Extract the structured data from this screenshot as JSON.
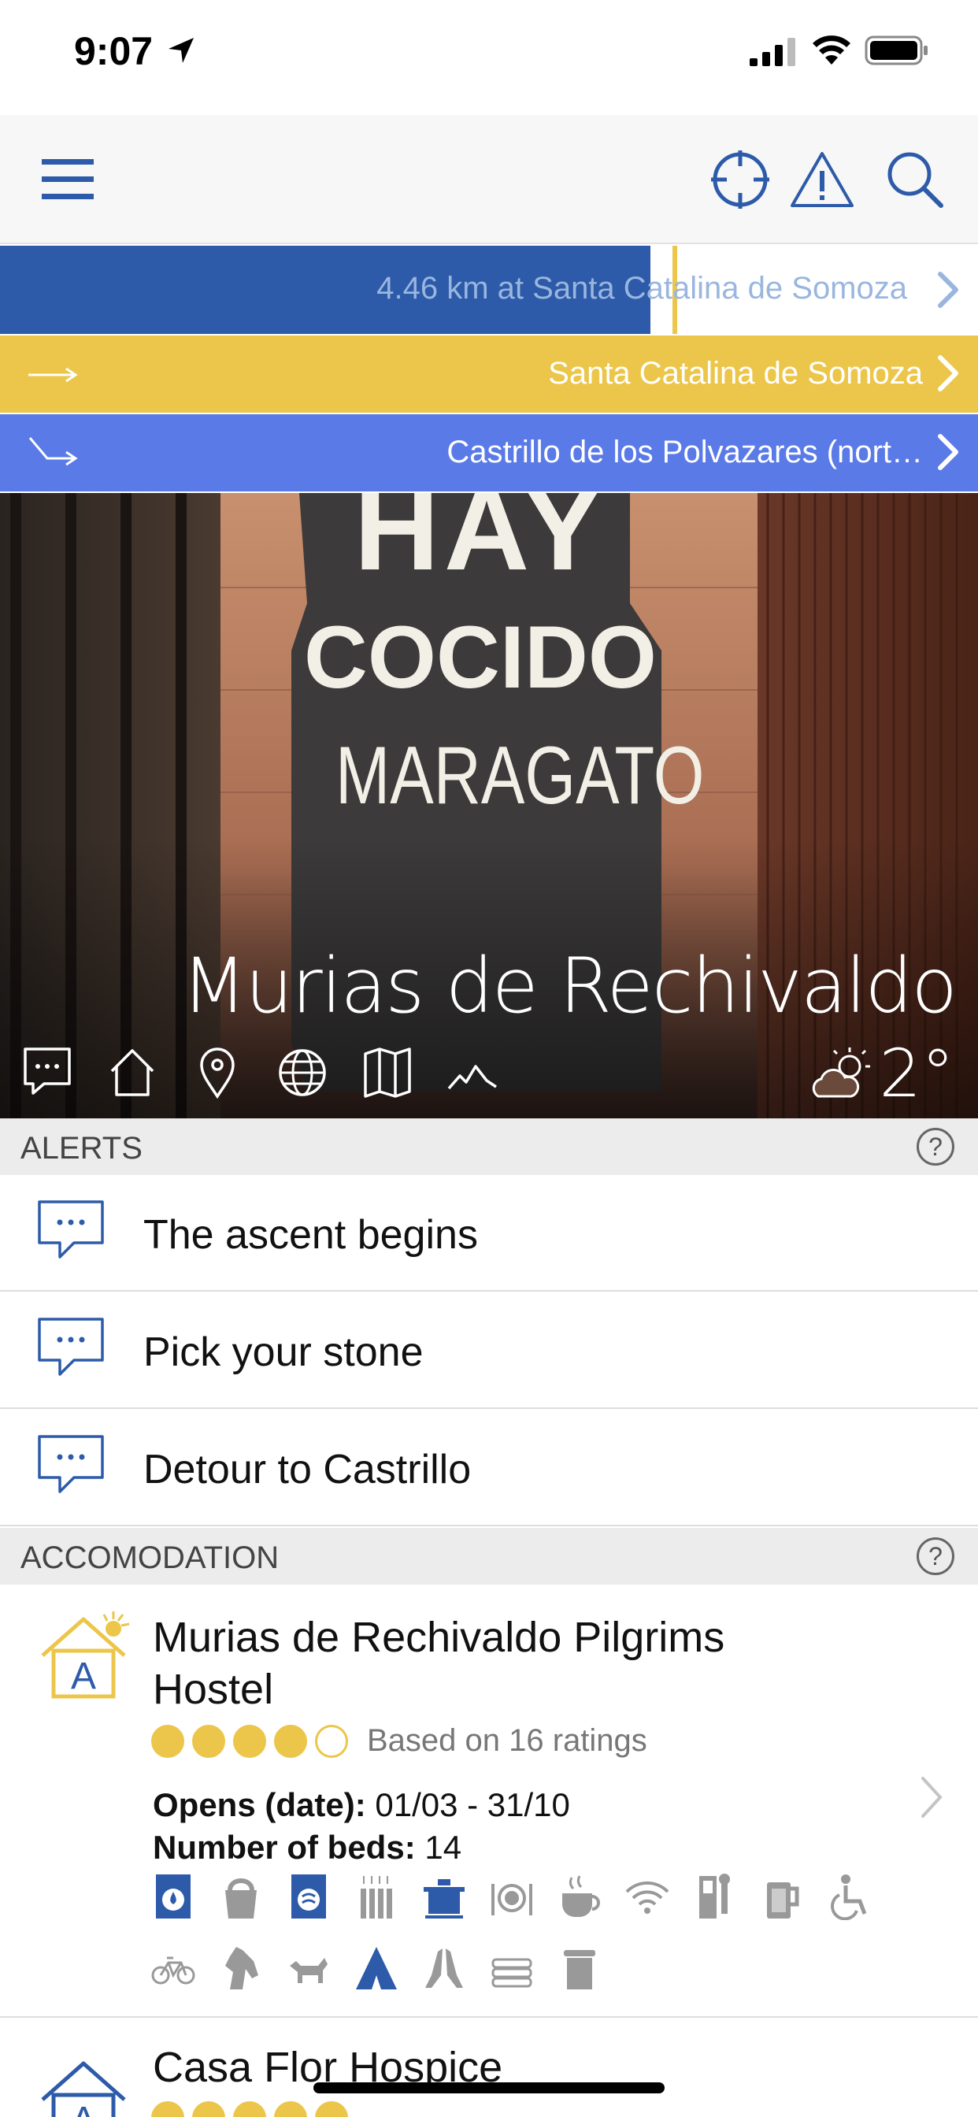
{
  "status_bar": {
    "time": "9:07"
  },
  "progress": {
    "text": "4.46 km at Santa Catalina de Somoza",
    "fraction": 0.665,
    "marker_fraction": 0.688
  },
  "routes": [
    {
      "text": "Santa Catalina de Somoza",
      "color": "#ecc64a",
      "arrow": "straight-arrow-icon"
    },
    {
      "text": "Castrillo de los Polvazares (nort…",
      "color": "#5a7ae7",
      "arrow": "diagonal-down-arrow-icon"
    }
  ],
  "hero": {
    "place_name": "Murias de Rechivaldo",
    "temperature": "2°",
    "weather_icon": "partly-cloudy-icon",
    "photo_sign_lines": [
      "HAY",
      "COCIDO",
      "MARAGATO"
    ],
    "icons": [
      "comment-icon",
      "home-icon",
      "map-pin-icon",
      "globe-icon",
      "map-icon",
      "elevation-icon"
    ]
  },
  "alerts": {
    "title": "ALERTS",
    "help": "?",
    "items": [
      {
        "text": "The ascent begins"
      },
      {
        "text": "Pick your stone"
      },
      {
        "text": "Detour to Castrillo"
      }
    ]
  },
  "accommodation": {
    "title": "ACCOMODATION",
    "help": "?",
    "items": [
      {
        "name": "Murias de Rechivaldo Pilgrims Hostel",
        "rating": 4,
        "rating_max": 5,
        "rating_text": "Based on 16 ratings",
        "opens_label": "Opens (date):",
        "opens_value": "01/03 - 31/10",
        "beds_label": "Number of beds:",
        "beds_value": "14",
        "logo_letter": "A"
      },
      {
        "name": "Casa Flor Hospice",
        "logo_letter": "A"
      }
    ]
  },
  "colors": {
    "brand_blue": "#2d5ba9",
    "yellow": "#ecc64a",
    "light_blue": "#5a7ae7"
  }
}
